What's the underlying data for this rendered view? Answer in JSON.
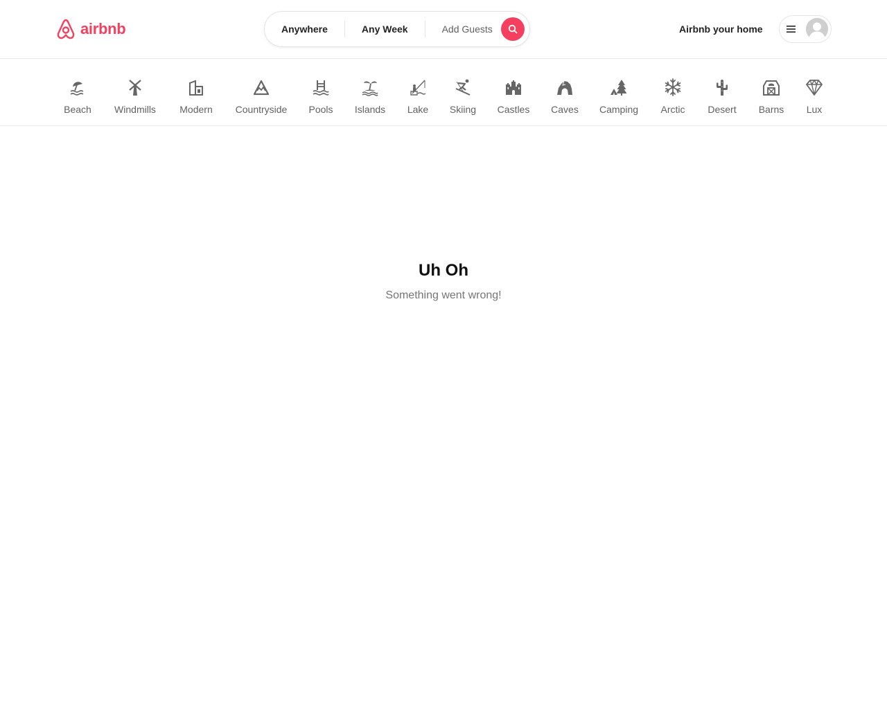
{
  "brand": {
    "name": "airbnb",
    "color": "#F43F5E"
  },
  "search": {
    "location": "Anywhere",
    "dates": "Any Week",
    "guests": "Add Guests",
    "search_icon": "search-icon"
  },
  "header": {
    "host_link": "Airbnb your home",
    "menu_icon": "hamburger-menu-icon",
    "avatar_icon": "user-avatar-icon"
  },
  "categories": [
    {
      "label": "Beach",
      "icon": "beach-umbrella-icon"
    },
    {
      "label": "Windmills",
      "icon": "windmill-icon"
    },
    {
      "label": "Modern",
      "icon": "modern-house-icon"
    },
    {
      "label": "Countryside",
      "icon": "mountain-icon"
    },
    {
      "label": "Pools",
      "icon": "pool-icon"
    },
    {
      "label": "Islands",
      "icon": "island-icon"
    },
    {
      "label": "Lake",
      "icon": "lake-fishing-icon"
    },
    {
      "label": "Skiing",
      "icon": "skier-icon"
    },
    {
      "label": "Castles",
      "icon": "castle-icon"
    },
    {
      "label": "Caves",
      "icon": "cave-icon"
    },
    {
      "label": "Camping",
      "icon": "camping-tent-icon"
    },
    {
      "label": "Arctic",
      "icon": "snowflake-icon"
    },
    {
      "label": "Desert",
      "icon": "cactus-icon"
    },
    {
      "label": "Barns",
      "icon": "barn-icon"
    },
    {
      "label": "Lux",
      "icon": "diamond-icon"
    }
  ],
  "error": {
    "title": "Uh Oh",
    "subtitle": "Something went wrong!"
  }
}
